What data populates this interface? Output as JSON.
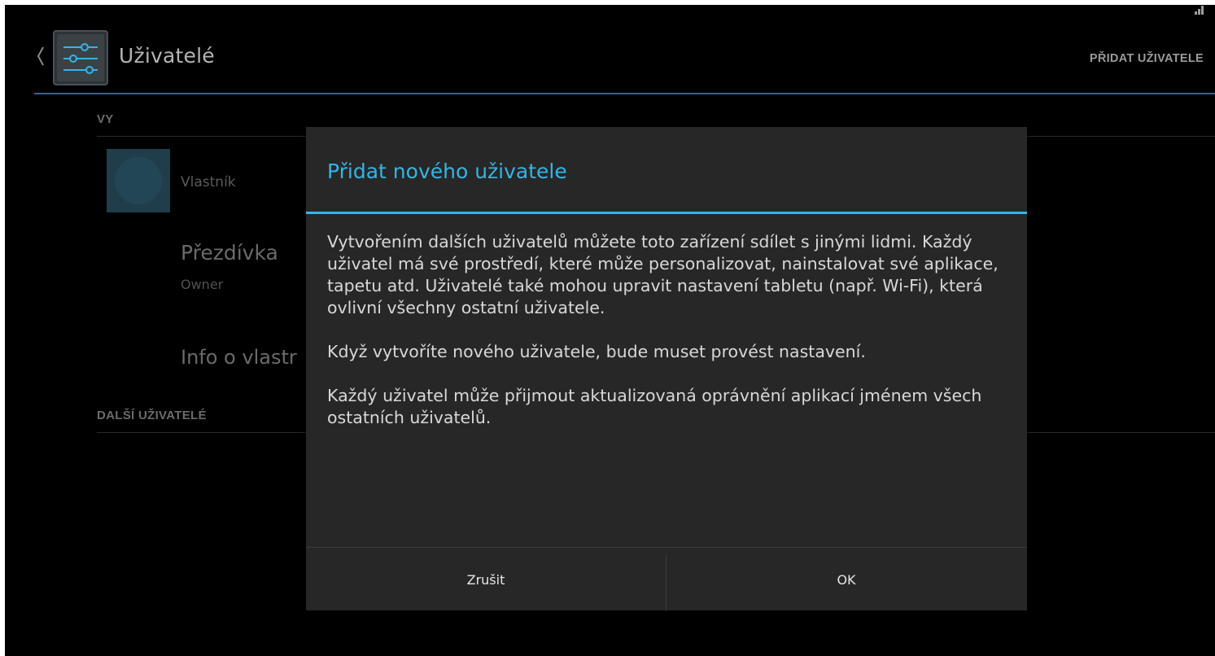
{
  "actionbar": {
    "title": "Uživatelé",
    "add_user_action": "PŘIDAT UŽIVATELE"
  },
  "list": {
    "section_you": "VY",
    "owner_label": "Vlastník",
    "nickname_title": "Přezdívka",
    "nickname_summary": "Owner",
    "owner_info": "Info o vlastr",
    "section_other_users": "DALŠÍ UŽIVATELÉ"
  },
  "dialog": {
    "title": "Přidat nového uživatele",
    "paragraphs": [
      "Vytvořením dalších uživatelů můžete toto zařízení sdílet s jinými lidmi. Každý uživatel má své prostředí, které může personalizovat, nainstalovat své aplikace, tapetu atd. Uživatelé také mohou upravit nastavení tabletu (např. Wi-Fi), která ovlivní všechny ostatní uživatele.",
      "Když vytvoříte nového uživatele, bude muset provést nastavení.",
      "Každý uživatel může přijmout aktualizovaná oprávnění aplikací jménem všech ostatních uživatelů."
    ],
    "cancel_label": "Zrušit",
    "ok_label": "OK"
  },
  "colors": {
    "accent": "#33b5e5",
    "background": "#000000",
    "dialog_background": "#272727"
  },
  "icons": {
    "up": "chevron-left-icon",
    "app": "settings-sliders-icon",
    "signal": "signal-icon"
  }
}
